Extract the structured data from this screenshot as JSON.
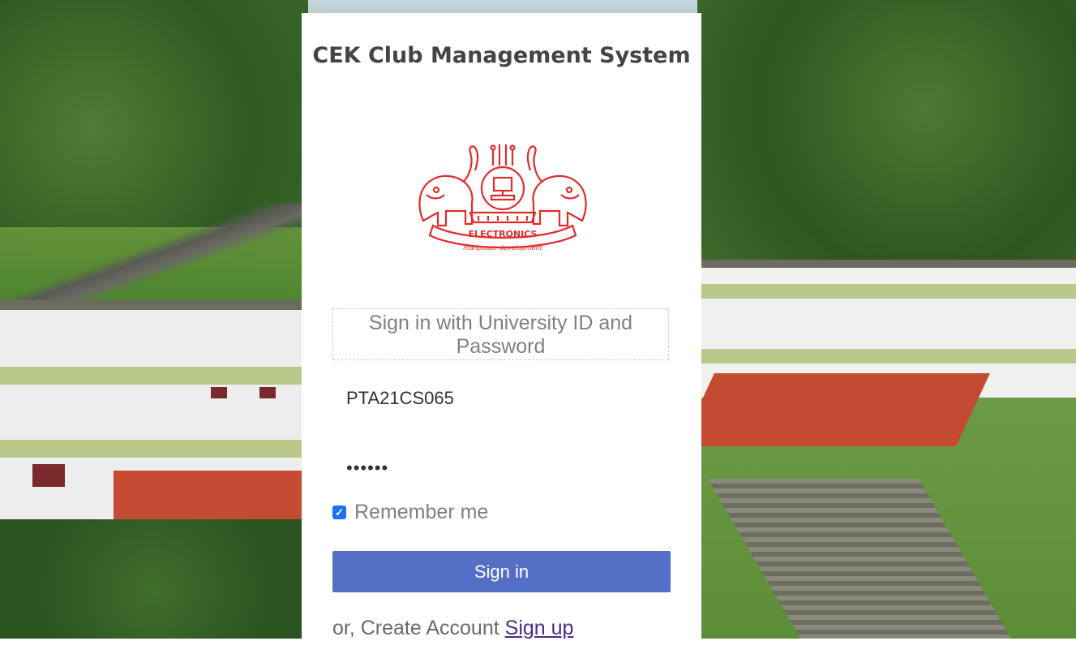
{
  "page": {
    "title": "CEK Club Management System"
  },
  "logo": {
    "text_top": "ELECTRONICS",
    "text_bottom": "manpower development",
    "color": "#e32b2b"
  },
  "form": {
    "hint": "Sign in with University ID and Password",
    "university_id": "PTA21CS065",
    "password_masked": "••••••",
    "remember_label": "Remember me",
    "remember_checked": true,
    "signin_label": "Sign in",
    "create_prefix": "or, Create Account",
    "signup_link": "Sign up"
  },
  "colors": {
    "button": "#5470c6",
    "checkbox": "#1a73e8",
    "link": "#4b2a8a"
  }
}
